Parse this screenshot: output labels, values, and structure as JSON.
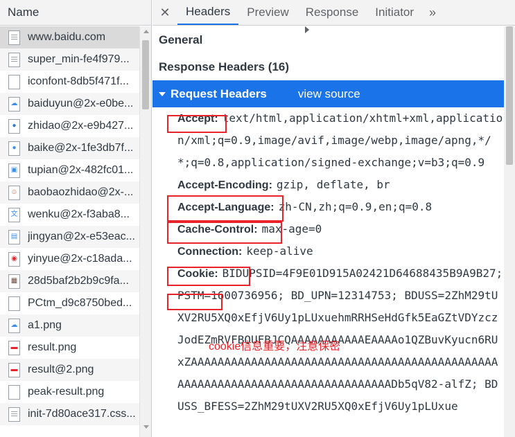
{
  "left_panel": {
    "header": "Name",
    "items": [
      {
        "name": "www.baidu.com",
        "icon": "doc-icon",
        "selected": true
      },
      {
        "name": "super_min-fe4f979...",
        "icon": "doc-icon"
      },
      {
        "name": "iconfont-8db5f471f...",
        "icon": "blank-file-icon"
      },
      {
        "name": "baiduyun@2x-e0be...",
        "icon": "baiduyun-icon"
      },
      {
        "name": "zhidao@2x-e9b427...",
        "icon": "zhidao-icon"
      },
      {
        "name": "baike@2x-1fe3db7f...",
        "icon": "baike-icon"
      },
      {
        "name": "tupian@2x-482fc01...",
        "icon": "tupian-icon"
      },
      {
        "name": "baobaozhidao@2x-...",
        "icon": "baobao-icon"
      },
      {
        "name": "wenku@2x-f3aba8...",
        "icon": "wenku-icon"
      },
      {
        "name": "jingyan@2x-e53eac...",
        "icon": "jingyan-icon"
      },
      {
        "name": "yinyue@2x-c18ada...",
        "icon": "yinyue-icon"
      },
      {
        "name": "28d5baf2b2b9c9fa...",
        "icon": "photo-icon"
      },
      {
        "name": "PCtm_d9c8750bed...",
        "icon": "blank-file-icon"
      },
      {
        "name": "a1.png",
        "icon": "cloud-icon"
      },
      {
        "name": "result.png",
        "icon": "baidu-logo-icon"
      },
      {
        "name": "result@2.png",
        "icon": "baidu-logo-icon"
      },
      {
        "name": "peak-result.png",
        "icon": "blank-file-icon"
      },
      {
        "name": "init-7d80ace317.css...",
        "icon": "doc-icon"
      }
    ]
  },
  "tabs": {
    "close": "✕",
    "items": [
      "Headers",
      "Preview",
      "Response",
      "Initiator"
    ],
    "active": "Headers",
    "more": "»"
  },
  "sections": {
    "general": "General",
    "response_headers": "Response Headers (16)",
    "request_headers": "Request Headers",
    "view_source": "view source"
  },
  "request_headers": [
    {
      "key": "Accept:",
      "value": "text/html,application/xhtml+xml,application/xml;q=0.9,image/avif,image/webp,image/apng,*/*;q=0.8,application/signed-exchange;v=b3;q=0.9"
    },
    {
      "key": "Accept-Encoding:",
      "value": "gzip, deflate, br"
    },
    {
      "key": "Accept-Language:",
      "value": "zh-CN,zh;q=0.9,en;q=0.8"
    },
    {
      "key": "Cache-Control:",
      "value": "max-age=0"
    },
    {
      "key": "Connection:",
      "value": "keep-alive"
    },
    {
      "key": "Cookie:",
      "value": "BIDUPSID=4F9E01D915A02421D64688435B9A9B27; PSTM=1600736956; BD_UPN=12314753; BDUSS=2ZhM29tUXV2RU5XQ0xEfjV6Uy1pLUxuehmRRHSeHdGfk5EaGZtVDYzczJodEZmRVFBQUFBJCQAAAAAAAAAAAEAAAAo1QZBuvKyucn6RUxZAAAAAAAAAAAAAAAAAAAAAAAAAAAAAAAAAAAAAAAAAAAAAAAAAAAAAAAAAAAAAAAAAAAAAAAAAAAAAADb5qV82-alfZ; BDUSS_BFESS=2ZhM29tUXV2RU5XQ0xEfjV6Uy1pLUxue"
    }
  ],
  "annotation": "cookie信息重要，注意保密",
  "colors": {
    "accent": "#1a73e8",
    "highlight_box": "#e8232a"
  }
}
